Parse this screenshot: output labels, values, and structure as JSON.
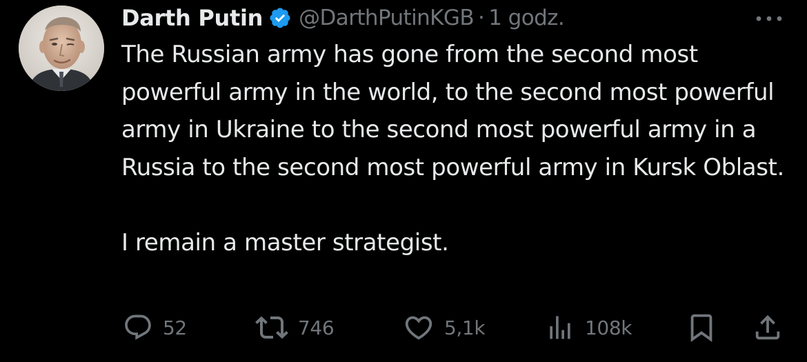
{
  "author": {
    "display_name": "Darth Putin",
    "handle": "@DarthPutinKGB",
    "separator": "·",
    "time": "1 godz.",
    "verified": true,
    "avatar_icon": "avatar-photo"
  },
  "tweet": {
    "paragraph_1": "The Russian army has gone from the second most powerful army in the world, to the second most powerful army in Ukraine to the second most powerful army in a Russia to the second most powerful army in Kursk Oblast.",
    "paragraph_2": "I remain a master strategist."
  },
  "actions": {
    "reply_count": "52",
    "retweet_count": "746",
    "like_count": "5,1k",
    "views_count": "108k"
  },
  "colors": {
    "background": "#000000",
    "text": "#e7e9ea",
    "secondary": "#71767b",
    "verified": "#1d9bf0"
  },
  "icons": [
    "more-icon",
    "verified-badge-icon",
    "reply-icon",
    "retweet-icon",
    "like-icon",
    "views-icon",
    "bookmark-icon",
    "share-icon"
  ]
}
